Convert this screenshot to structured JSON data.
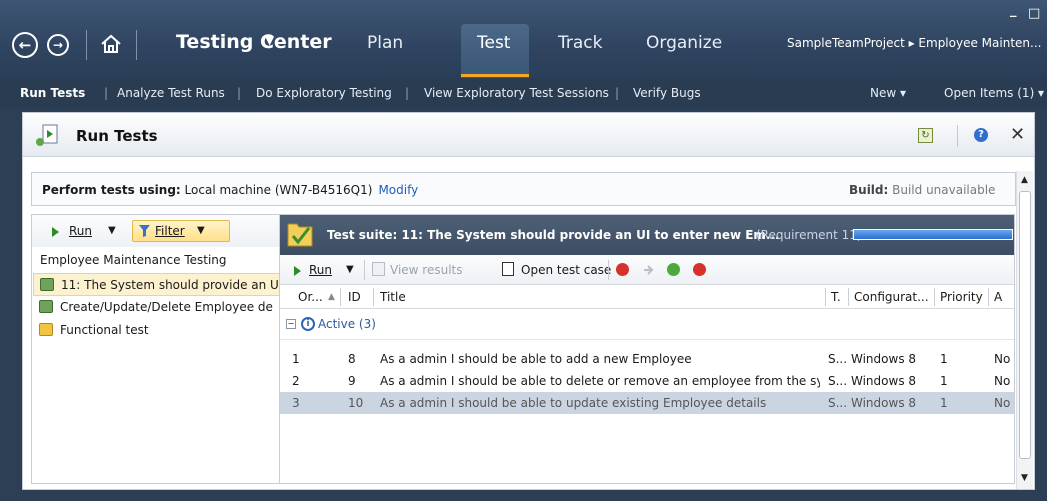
{
  "window": {
    "minimize": "_",
    "maximize": "□",
    "close": "×"
  },
  "header": {
    "app_title": "Testing Center",
    "tabs": [
      {
        "label": "Plan"
      },
      {
        "label": "Test"
      },
      {
        "label": "Track"
      },
      {
        "label": "Organize"
      }
    ],
    "project_breadcrumb": "SampleTeamProject ▸ Employee Mainten..."
  },
  "subnav": {
    "items": [
      {
        "label": "Run Tests"
      },
      {
        "label": "Analyze Test Runs"
      },
      {
        "label": "Do Exploratory Testing"
      },
      {
        "label": "View Exploratory Test Sessions"
      },
      {
        "label": "Verify Bugs"
      }
    ],
    "new_label": "New ▾",
    "open_items_label": "Open Items (1) ▾"
  },
  "panel": {
    "title": "Run Tests",
    "perform_label": "Perform tests using:",
    "perform_value": " Local machine (WN7-B4516Q1)",
    "modify_link": "Modify",
    "build_label": "Build:",
    "build_value": " Build unavailable"
  },
  "left": {
    "run_label": "Run",
    "filter_label": "Filter",
    "heading": "Employee Maintenance Testing",
    "items": [
      {
        "label": "11: The System should provide an U"
      },
      {
        "label": "Create/Update/Delete Employee de"
      },
      {
        "label": "Functional test"
      }
    ]
  },
  "suite": {
    "label": "Test suite:  11: The System should provide an UI to enter new Em...",
    "requirement": "(Requirement 11)",
    "progress": 1.0
  },
  "toolbar": {
    "run_label": "Run",
    "view_results_label": "View results",
    "open_test_case_label": "Open test case"
  },
  "grid": {
    "columns": [
      "Or...",
      "ID",
      "Title",
      "T.",
      "Configurat...",
      "Priority",
      "A"
    ],
    "group_label": "Active (3)",
    "rows": [
      {
        "order": "1",
        "id": "8",
        "title": "As a admin I should be able to add a new Employee",
        "t": "S...",
        "config": "Windows 8",
        "priority": "1",
        "a": "No"
      },
      {
        "order": "2",
        "id": "9",
        "title": "As a admin I should be able to delete or remove an employee from the sy...",
        "t": "S...",
        "config": "Windows 8",
        "priority": "1",
        "a": "No"
      },
      {
        "order": "3",
        "id": "10",
        "title": "As a admin I should be able to update existing Employee details",
        "t": "S...",
        "config": "Windows 8",
        "priority": "1",
        "a": "No"
      }
    ]
  }
}
